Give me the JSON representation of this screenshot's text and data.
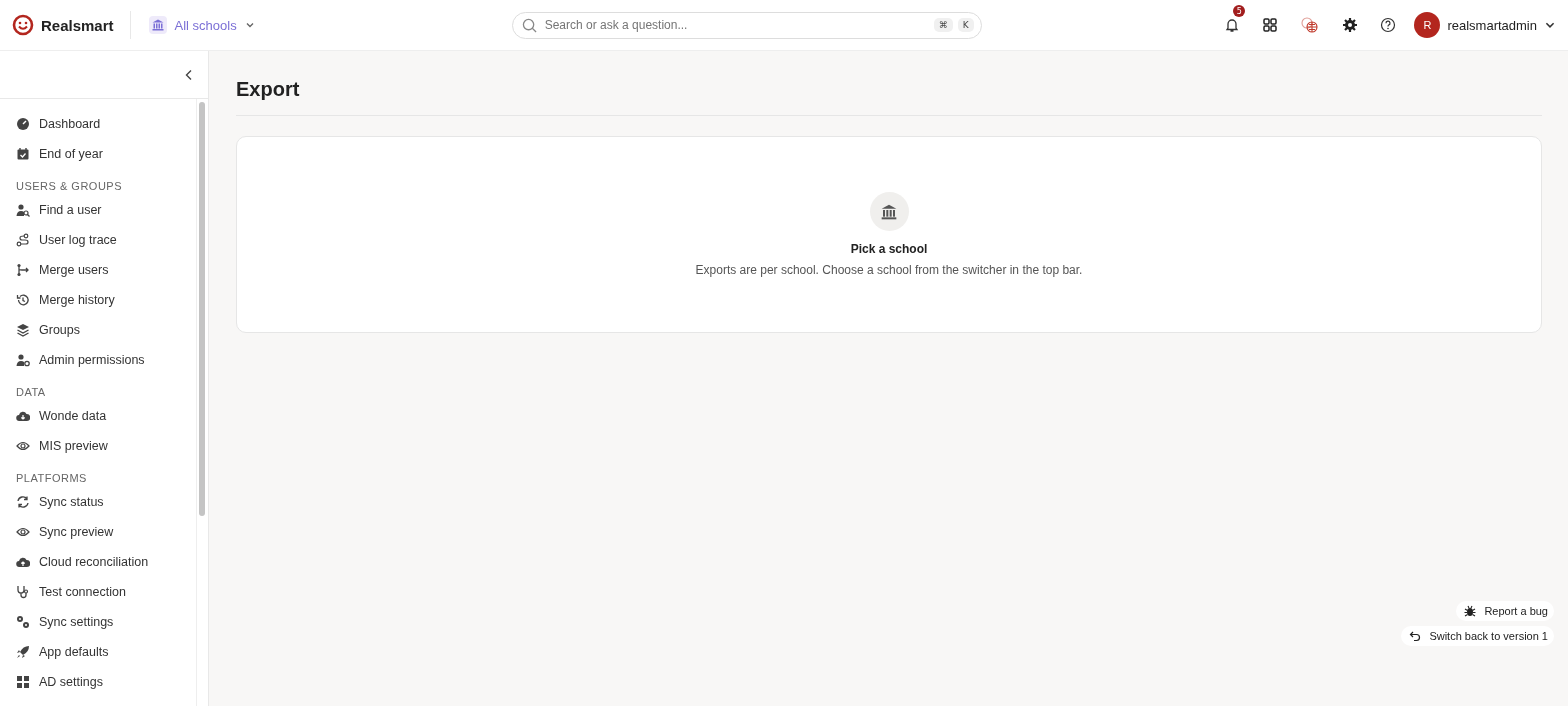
{
  "topbar": {
    "brand": "Realsmart",
    "school_switcher": "All schools",
    "search": {
      "placeholder": "Search or ask a question...",
      "shortcut": [
        "⌘",
        "K"
      ]
    },
    "notifications_badge": "5",
    "user": {
      "initial": "R",
      "name": "realsmartadmin"
    }
  },
  "sidebar": {
    "sections": [
      {
        "items": [
          "Dashboard",
          "End of year"
        ]
      },
      {
        "heading": "USERS & GROUPS",
        "items": [
          "Find a user",
          "User log trace",
          "Merge users",
          "Merge history",
          "Groups",
          "Admin permissions"
        ]
      },
      {
        "heading": "DATA",
        "items": [
          "Wonde data",
          "MIS preview"
        ]
      },
      {
        "heading": "PLATFORMS",
        "items": [
          "Sync status",
          "Sync preview",
          "Cloud reconciliation",
          "Test connection",
          "Sync settings",
          "App defaults",
          "AD settings"
        ]
      }
    ]
  },
  "page": {
    "title": "Export",
    "empty_state": {
      "title": "Pick a school",
      "message": "Exports are per school. Choose a school from the switcher in the top bar."
    }
  },
  "floating_buttons": [
    "Report a bug",
    "Switch back to version 1"
  ]
}
